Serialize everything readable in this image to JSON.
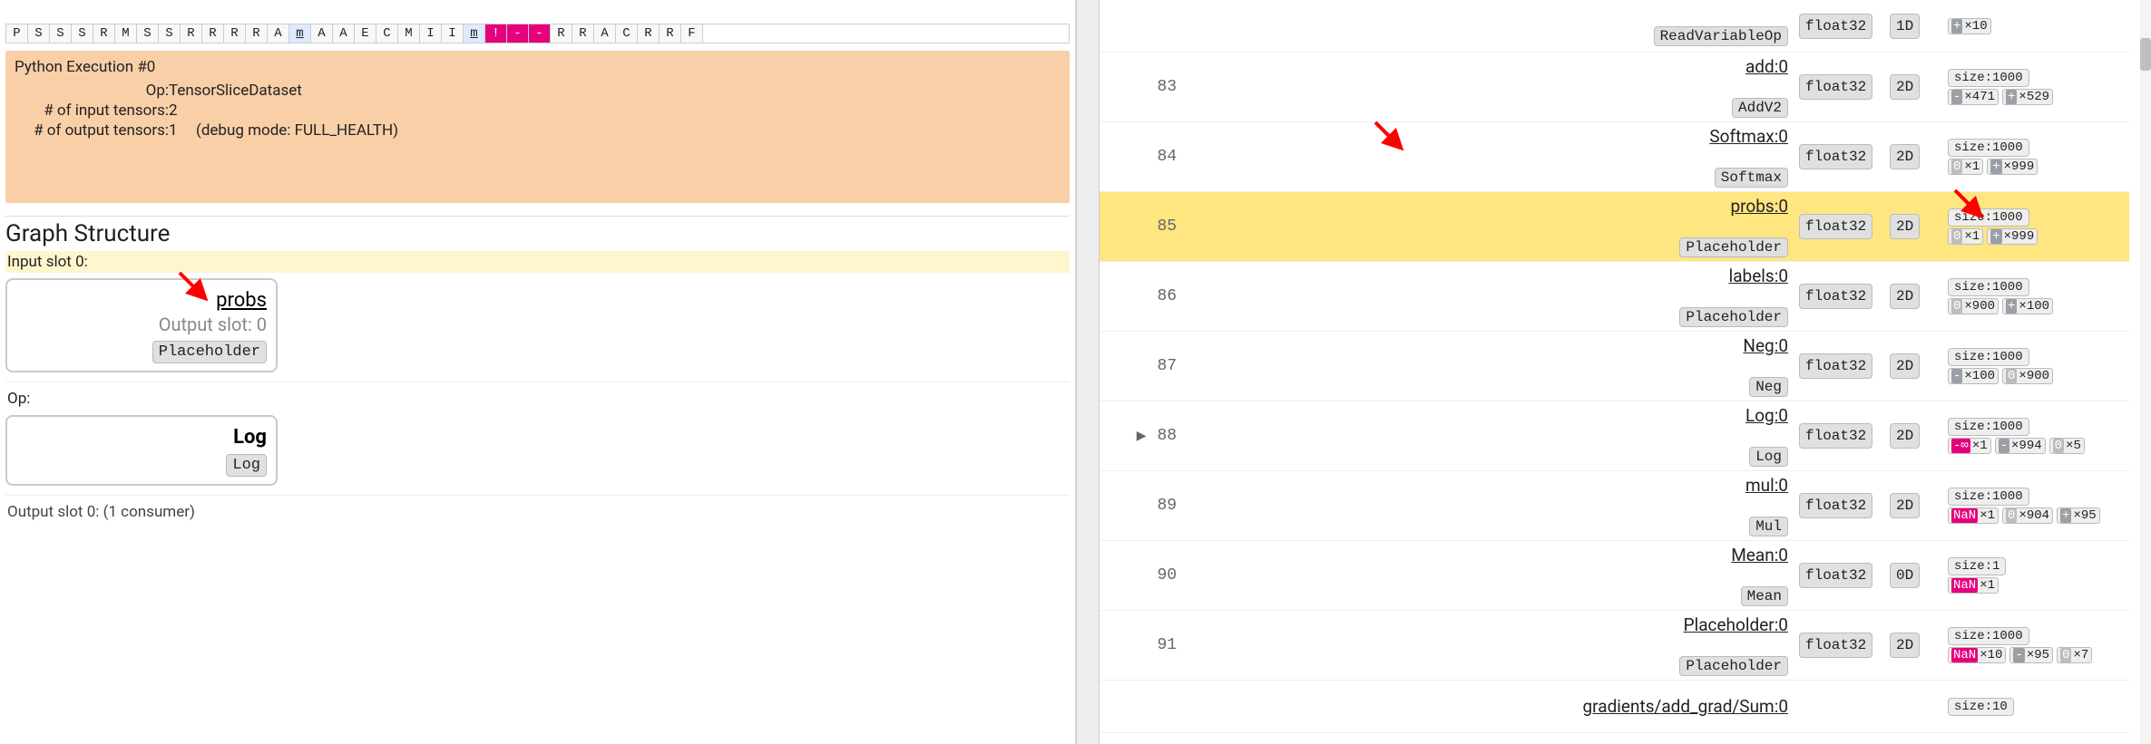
{
  "timeline": {
    "cells": [
      "P",
      "S",
      "S",
      "S",
      "R",
      "M",
      "S",
      "S",
      "R",
      "R",
      "R",
      "R",
      "A",
      "m",
      "A",
      "A",
      "E",
      "C",
      "M",
      "I",
      "I",
      "m",
      "!",
      "-",
      "-",
      "R",
      "R",
      "A",
      "C",
      "R",
      "R",
      "F"
    ],
    "highlighted_indices": [
      13,
      21
    ],
    "pink_indices": [
      22,
      23,
      24
    ]
  },
  "detail": {
    "title": "Python Execution #0",
    "rows": [
      {
        "label": "Op:",
        "value": "TensorSliceDataset"
      },
      {
        "label": "# of input tensors:",
        "value": "2"
      },
      {
        "label": "# of output tensors:",
        "value": "1",
        "extra": "(debug mode: FULL_HEALTH)"
      }
    ]
  },
  "graph": {
    "section_title": "Graph Structure",
    "input_slot_label": "Input slot 0:",
    "input_card": {
      "name": "probs",
      "sub": "Output slot: 0",
      "chip": "Placeholder"
    },
    "op_label": "Op:",
    "op_card": {
      "name": "Log",
      "chip": "Log"
    },
    "output_slot_label": "Output slot 0: (1 consumer)"
  },
  "rows": [
    {
      "idx": "",
      "name": "",
      "type": "ReadVariableOp",
      "dtype": "float32",
      "rank": "1D",
      "size": "",
      "health": [
        {
          "tag": "+",
          "v": "×10"
        }
      ]
    },
    {
      "idx": "83",
      "name": "add:0",
      "type": "AddV2",
      "dtype": "float32",
      "rank": "2D",
      "size": "size:1000",
      "health": [
        {
          "tag": "-",
          "v": "×471"
        },
        {
          "tag": "+",
          "v": "×529"
        }
      ]
    },
    {
      "idx": "84",
      "name": "Softmax:0",
      "type": "Softmax",
      "dtype": "float32",
      "rank": "2D",
      "size": "size:1000",
      "health": [
        {
          "tag": "0",
          "v": "×1"
        },
        {
          "tag": "+",
          "v": "×999"
        }
      ],
      "arrow": true
    },
    {
      "idx": "85",
      "name": "probs:0",
      "type": "Placeholder",
      "dtype": "float32",
      "rank": "2D",
      "size": "size:1000",
      "health": [
        {
          "tag": "0",
          "v": "×1"
        },
        {
          "tag": "+",
          "v": "×999"
        }
      ],
      "hl": true,
      "arrow_right": true
    },
    {
      "idx": "86",
      "name": "labels:0",
      "type": "Placeholder",
      "dtype": "float32",
      "rank": "2D",
      "size": "size:1000",
      "health": [
        {
          "tag": "0",
          "v": "×900"
        },
        {
          "tag": "+",
          "v": "×100"
        }
      ]
    },
    {
      "idx": "87",
      "name": "Neg:0",
      "type": "Neg",
      "dtype": "float32",
      "rank": "2D",
      "size": "size:1000",
      "health": [
        {
          "tag": "-",
          "v": "×100"
        },
        {
          "tag": "0",
          "v": "×900"
        }
      ]
    },
    {
      "idx": "88",
      "name": "Log:0",
      "type": "Log",
      "dtype": "float32",
      "rank": "2D",
      "size": "size:1000",
      "health": [
        {
          "tag": "-∞",
          "v": "×1"
        },
        {
          "tag": "-",
          "v": "×994"
        },
        {
          "tag": "0",
          "v": "×5"
        }
      ],
      "expand": true
    },
    {
      "idx": "89",
      "name": "mul:0",
      "type": "Mul",
      "dtype": "float32",
      "rank": "2D",
      "size": "size:1000",
      "health": [
        {
          "tag": "NaN",
          "v": "×1"
        },
        {
          "tag": "0",
          "v": "×904"
        },
        {
          "tag": "+",
          "v": "×95"
        }
      ]
    },
    {
      "idx": "90",
      "name": "Mean:0",
      "type": "Mean",
      "dtype": "float32",
      "rank": "0D",
      "size": "size:1",
      "health": [
        {
          "tag": "NaN",
          "v": "×1"
        }
      ]
    },
    {
      "idx": "91",
      "name": "Placeholder:0",
      "type": "Placeholder",
      "dtype": "float32",
      "rank": "2D",
      "size": "size:1000",
      "health": [
        {
          "tag": "NaN",
          "v": "×10"
        },
        {
          "tag": "-",
          "v": "×95"
        },
        {
          "tag": "0",
          "v": "×7"
        }
      ]
    },
    {
      "idx": "",
      "name": "gradients/add_grad/Sum:0",
      "type": "",
      "dtype": "",
      "rank": "",
      "size": "size:10",
      "health": []
    }
  ]
}
